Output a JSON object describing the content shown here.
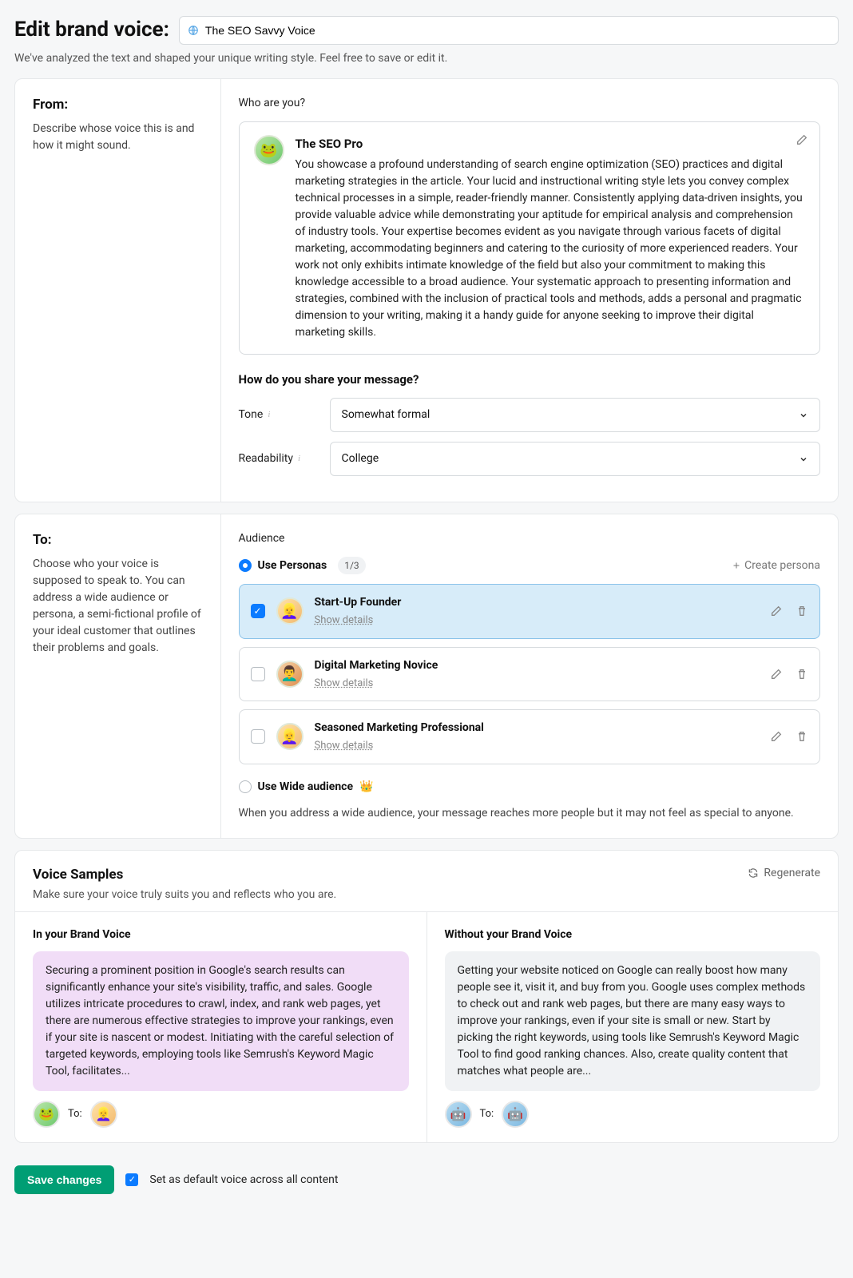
{
  "header": {
    "title": "Edit brand voice:",
    "voice_name": "The SEO Savvy Voice",
    "subtitle": "We've analyzed the text and shaped your unique writing style. Feel free to save or edit it."
  },
  "from": {
    "heading": "From:",
    "desc": "Describe whose voice this is and how it might sound.",
    "who_label": "Who are you?",
    "persona": {
      "name": "The SEO Pro",
      "emoji": "🐸",
      "desc": "You showcase a profound understanding of search engine optimization (SEO) practices and digital marketing strategies in the article. Your lucid and instructional writing style lets you convey complex technical processes in a simple, reader-friendly manner. Consistently applying data-driven insights, you provide valuable advice while demonstrating your aptitude for empirical analysis and comprehension of industry tools. Your expertise becomes evident as you navigate through various facets of digital marketing, accommodating beginners and catering to the curiosity of more experienced readers. Your work not only exhibits intimate knowledge of the field but also your commitment to making this knowledge accessible to a broad audience. Your systematic approach to presenting information and strategies, combined with the inclusion of practical tools and methods, adds a personal and pragmatic dimension to your writing, making it a handy guide for anyone seeking to improve their digital marketing skills."
    },
    "message_heading": "How do you share your message?",
    "tone_label": "Tone",
    "tone_value": "Somewhat formal",
    "readability_label": "Readability",
    "readability_value": "College"
  },
  "to": {
    "heading": "To:",
    "desc": "Choose who your voice is supposed to speak to. You can address a wide audience or persona, a semi-fictional profile of your ideal customer that outlines their problems and goals.",
    "audience_label": "Audience",
    "use_personas_label": "Use Personas",
    "persona_count": "1/3",
    "create_label": "Create persona",
    "personas": [
      {
        "name": "Start-Up Founder",
        "emoji": "👱‍♀️",
        "checked": true,
        "details": "Show details"
      },
      {
        "name": "Digital Marketing Novice",
        "emoji": "👨‍🦱",
        "checked": false,
        "details": "Show details"
      },
      {
        "name": "Seasoned Marketing Professional",
        "emoji": "👱‍♀️",
        "checked": false,
        "details": "Show details"
      }
    ],
    "use_wide_label": "Use Wide audience",
    "wide_desc": "When you address a wide audience, your message reaches more people but it may not feel as special to anyone."
  },
  "samples": {
    "heading": "Voice Samples",
    "subtitle": "Make sure your voice truly suits you and reflects who you are.",
    "regenerate": "Regenerate",
    "with_label": "In your Brand Voice",
    "without_label": "Without your Brand Voice",
    "with_text": "Securing a prominent position in Google's search results can significantly enhance your site's visibility, traffic, and sales. Google utilizes intricate procedures to crawl, index, and rank web pages, yet there are numerous effective strategies to improve your rankings, even if your site is nascent or modest. Initiating with the careful selection of targeted keywords, employing tools like Semrush's Keyword Magic Tool, facilitates...",
    "without_text": "Getting your website noticed on Google can really boost how many people see it, visit it, and buy from you. Google uses complex methods to check out and rank web pages, but there are many easy ways to improve your rankings, even if your site is small or new. Start by picking the right keywords, using tools like Semrush's Keyword Magic Tool to find good ranking chances. Also, create quality content that matches what people are...",
    "to_label": "To:"
  },
  "footer": {
    "save": "Save changes",
    "default_label": "Set as default voice across all content"
  }
}
